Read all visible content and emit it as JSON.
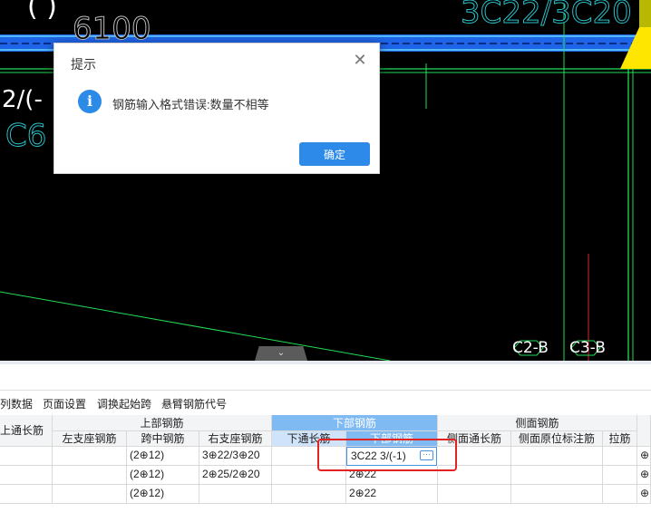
{
  "cad": {
    "top_left_text": "(    )",
    "dim_top": "6100",
    "rebar_top_right": "3C22/3C20",
    "left_label_1": "2/(-",
    "left_label_2": "C6",
    "axis_labels": [
      "C2-B",
      "C3-B"
    ],
    "scroll_tab_icon": "chevron-down-icon"
  },
  "toolbar": {
    "items": [
      "列数据",
      "页面设置",
      "调换起始跨",
      "悬臂钢筋代号"
    ]
  },
  "grid": {
    "left_header": "上通长筋",
    "groups": {
      "top": "上部钢筋",
      "bottom": "下部钢筋",
      "side": "侧面钢筋"
    },
    "columns": [
      "左支座钢筋",
      "跨中钢筋",
      "右支座钢筋",
      "下通长筋",
      "下部钢筋",
      "侧面通长筋",
      "侧面原位标注筋",
      "拉筋"
    ],
    "rows": [
      {
        "left_support": "",
        "mid_span": "(2⊕12)",
        "right_support": "3⊕22/3⊕20",
        "bottom_through": "",
        "bottom": "3C22 3/(-1)",
        "side_through": "",
        "side_inplace": "",
        "tie": "",
        "extra": "⊕"
      },
      {
        "left_support": "",
        "mid_span": "(2⊕12)",
        "right_support": "2⊕25/2⊕20",
        "bottom_through": "",
        "bottom": "2⊕22",
        "side_through": "",
        "side_inplace": "",
        "tie": "",
        "extra": "⊕"
      },
      {
        "left_support": "",
        "mid_span": "(2⊕12)",
        "right_support": "",
        "bottom_through": "",
        "bottom": "2⊕22",
        "side_through": "",
        "side_inplace": "",
        "tie": "",
        "extra": "⊕"
      }
    ]
  },
  "modal": {
    "title": "提示",
    "message": "钢筋输入格式错误:数量不相等",
    "ok_label": "确定",
    "close_icon": "close-icon",
    "info_icon": "info-icon",
    "accent": "#2d8ae8"
  },
  "editor": {
    "value": "3C22 3/(-1)",
    "ellipsis_icon": "ellipsis-icon"
  }
}
